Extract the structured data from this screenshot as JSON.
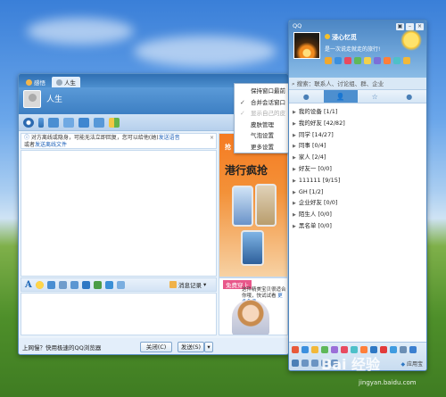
{
  "chat_window": {
    "tabs": [
      {
        "label": "感悟"
      },
      {
        "label": "人生"
      }
    ],
    "contact_name": "人生",
    "notice": {
      "text": "对方离线或隐身，可能无法立即回复，您可以给他(她)",
      "link1": "发送语音",
      "text2": "或者",
      "link2": "发送离线文件"
    },
    "message_record_label": "消息记录",
    "footer_text": "上网慢？快用极速的QQ浏览器",
    "close_button": "关闭(C)",
    "send_button": "发送(S)",
    "ad_top": {
      "headline": "港行疯抢",
      "tag": "抢"
    },
    "ad_bottom": {
      "title": "免费穿上",
      "text": "这件精美宝贝很适合你哦，快试试看",
      "link": "更多免费"
    }
  },
  "context_menu": {
    "items": [
      {
        "label": "保持窗口最前",
        "checked": false,
        "disabled": false
      },
      {
        "label": "合并会话窗口",
        "checked": true,
        "disabled": false
      },
      {
        "label": "显示自己的皮肤",
        "checked": true,
        "disabled": true
      },
      {
        "label": "皮肤管理",
        "checked": false,
        "disabled": false
      },
      {
        "label": "气泡设置",
        "checked": false,
        "disabled": false
      },
      {
        "label": "更多设置",
        "checked": false,
        "disabled": false
      }
    ]
  },
  "qq_panel": {
    "title": "QQ",
    "nickname": "浸心忆觅",
    "signature": "是一次说走就走的旅行!",
    "search_placeholder": "搜索：联系人、讨论组、群、企业",
    "groups": [
      {
        "label": "我的设备",
        "count": "[1/1]"
      },
      {
        "label": "我的好友",
        "count": "[42/82]"
      },
      {
        "label": "同学",
        "count": "[14/27]"
      },
      {
        "label": "同事",
        "count": "[0/4]"
      },
      {
        "label": "家人",
        "count": "[2/4]"
      },
      {
        "label": "好友一",
        "count": "[0/0]"
      },
      {
        "label": "111111",
        "count": "[9/15]"
      },
      {
        "label": "GH",
        "count": "[1/2]"
      },
      {
        "label": "企业好友",
        "count": "[0/0]"
      },
      {
        "label": "陌生人",
        "count": "[0/0]"
      },
      {
        "label": "黑名单",
        "count": "[0/0]"
      }
    ],
    "app_center_label": "应用宝"
  },
  "watermark": {
    "brand": "Bai 经验",
    "url": "jingyan.baidu.com"
  }
}
